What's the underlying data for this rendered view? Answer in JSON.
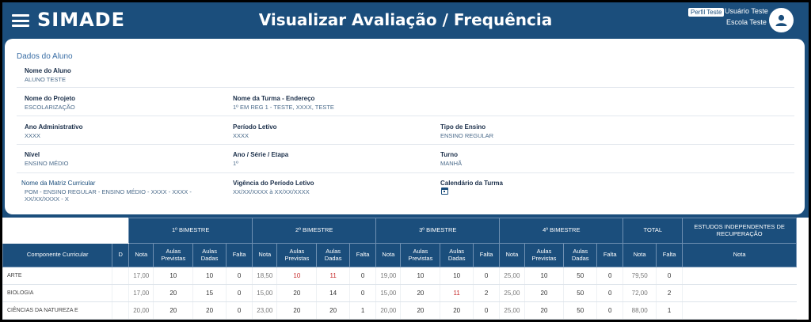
{
  "header": {
    "logo": "SIMADE",
    "title": "Visualizar Avaliação / Frequência",
    "profile_badge": "Perfil Teste",
    "user_name": "Usuário Teste",
    "school_name": "Escola Teste",
    "menu_icon": "hamburger-menu-icon",
    "avatar_icon": "user-avatar-icon"
  },
  "student": {
    "section_title": "Dados do Aluno",
    "nome_aluno": {
      "label": "Nome do Aluno",
      "value": "ALUNO TESTE"
    },
    "nome_projeto": {
      "label": "Nome do Projeto",
      "value": "ESCOLARIZAÇÃO"
    },
    "nome_turma": {
      "label": "Nome da Turma - Endereço",
      "value": "1º EM REG 1 - TESTE, XXXX, TESTE"
    },
    "ano_administrativo": {
      "label": "Ano Administrativo",
      "value": "XXXX"
    },
    "periodo_letivo": {
      "label": "Período Letivo",
      "value": "XXXX"
    },
    "tipo_ensino": {
      "label": "Tipo de Ensino",
      "value": "ENSINO REGULAR"
    },
    "nivel": {
      "label": "Nível",
      "value": "ENSINO MÉDIO"
    },
    "ano_serie": {
      "label": "Ano / Série / Etapa",
      "value": "1º"
    },
    "turno": {
      "label": "Turno",
      "value": "MANHÃ"
    },
    "matriz": {
      "label": "Nome da Matriz Curricular",
      "value_line1": "POM - ENSINO REGULAR - ENSINO MÉDIO - XXXX - XXXX -",
      "value_line2": "XX/XX/XXXX - X"
    },
    "vigencia": {
      "label": "Vigência do Período Letivo",
      "value": "XX/XX/XXXX à XX/XX/XXXX"
    },
    "calendario": {
      "label": "Calendário da Turma",
      "icon": "calendar-icon"
    }
  },
  "grades": {
    "groups": {
      "b1": "1º BIMESTRE",
      "b2": "2º BIMESTRE",
      "b3": "3º BIMESTRE",
      "b4": "4º BIMESTRE",
      "total": "TOTAL",
      "estudos": "ESTUDOS INDEPENDENTES DE RECUPERAÇÃO"
    },
    "columns": {
      "componente": "Componente Curricular",
      "d": "D",
      "nota": "Nota",
      "aulas_previstas": "Aulas Previstas",
      "aulas_dadas": "Aulas Dadas",
      "falta": "Falta"
    },
    "rows": [
      {
        "componente": "ARTE",
        "d": "",
        "b1": [
          "17,00",
          "10",
          "10",
          "0"
        ],
        "b2": [
          "18,50",
          "10",
          "11",
          "0"
        ],
        "b3": [
          "19,00",
          "10",
          "10",
          "0"
        ],
        "b4": [
          "25,00",
          "10",
          "50",
          "0"
        ],
        "total": [
          "79,50",
          "0"
        ],
        "recuperacao": ""
      },
      {
        "componente": "BIOLOGIA",
        "d": "",
        "b1": [
          "17,00",
          "20",
          "15",
          "0"
        ],
        "b2": [
          "15,00",
          "20",
          "14",
          "0"
        ],
        "b3": [
          "15,00",
          "20",
          "11",
          "2"
        ],
        "b4": [
          "25,00",
          "20",
          "50",
          "0"
        ],
        "total": [
          "72,00",
          "2"
        ],
        "recuperacao": ""
      },
      {
        "componente": "CIÊNCIAS DA NATUREZA E",
        "d": "",
        "b1": [
          "20,00",
          "20",
          "20",
          "0"
        ],
        "b2": [
          "23,00",
          "20",
          "20",
          "1"
        ],
        "b3": [
          "20,00",
          "20",
          "20",
          "0"
        ],
        "b4": [
          "25,00",
          "20",
          "50",
          "0"
        ],
        "total": [
          "88,00",
          "1"
        ],
        "recuperacao": ""
      }
    ],
    "highlight_color": "#c62828"
  },
  "colors": {
    "primary": "#1b4e7c",
    "card": "#ffffff",
    "label": "#1b2f4a",
    "value": "#4a6a8a"
  }
}
